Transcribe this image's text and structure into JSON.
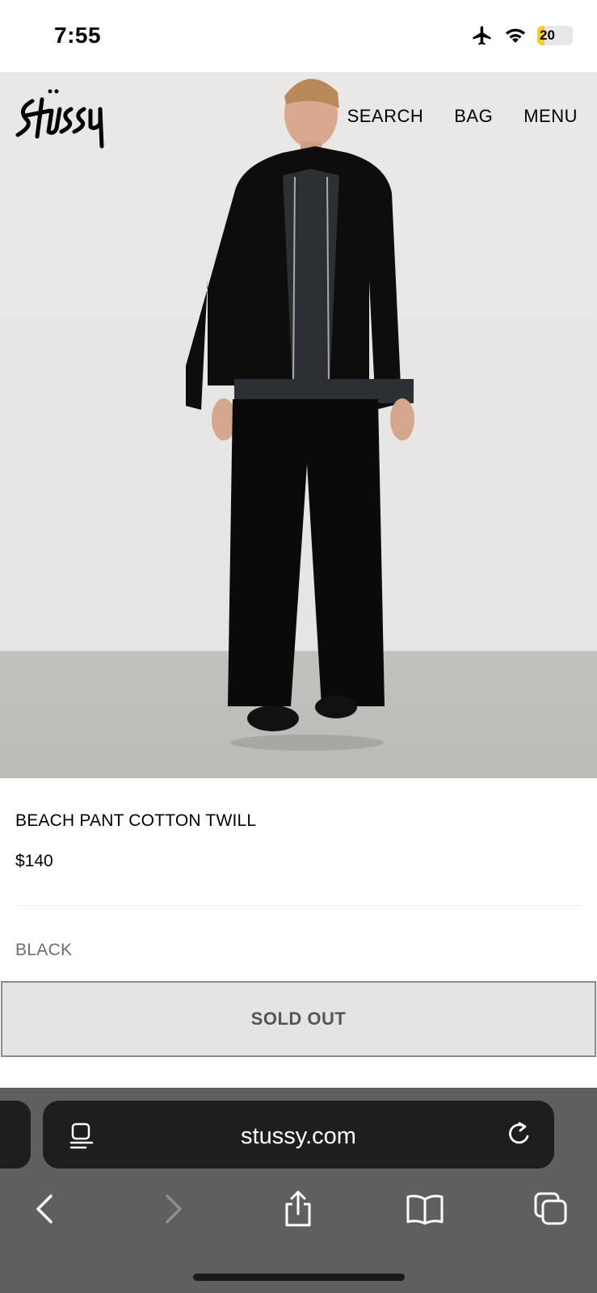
{
  "status_bar": {
    "time": "7:55",
    "battery_level": "20",
    "icons": [
      "airplane-icon",
      "wifi-icon",
      "battery-icon"
    ]
  },
  "header": {
    "logo": "Stüssy",
    "nav": [
      {
        "label": "SEARCH"
      },
      {
        "label": "BAG"
      },
      {
        "label": "MENU"
      }
    ]
  },
  "product": {
    "title": "BEACH PANT COTTON TWILL",
    "price": "$140",
    "color": "BLACK",
    "cta_label": "SOLD OUT"
  },
  "browser": {
    "url": "stussy.com",
    "toolbar_icons": [
      "back-icon",
      "forward-icon",
      "share-icon",
      "bookmarks-icon",
      "tabs-icon"
    ]
  },
  "colors": {
    "sold_out_bg": "#e4e4e4",
    "browser_chrome": "#5f5f5f",
    "address_bar": "#1e1e1e",
    "battery_low": "#f5d020"
  }
}
